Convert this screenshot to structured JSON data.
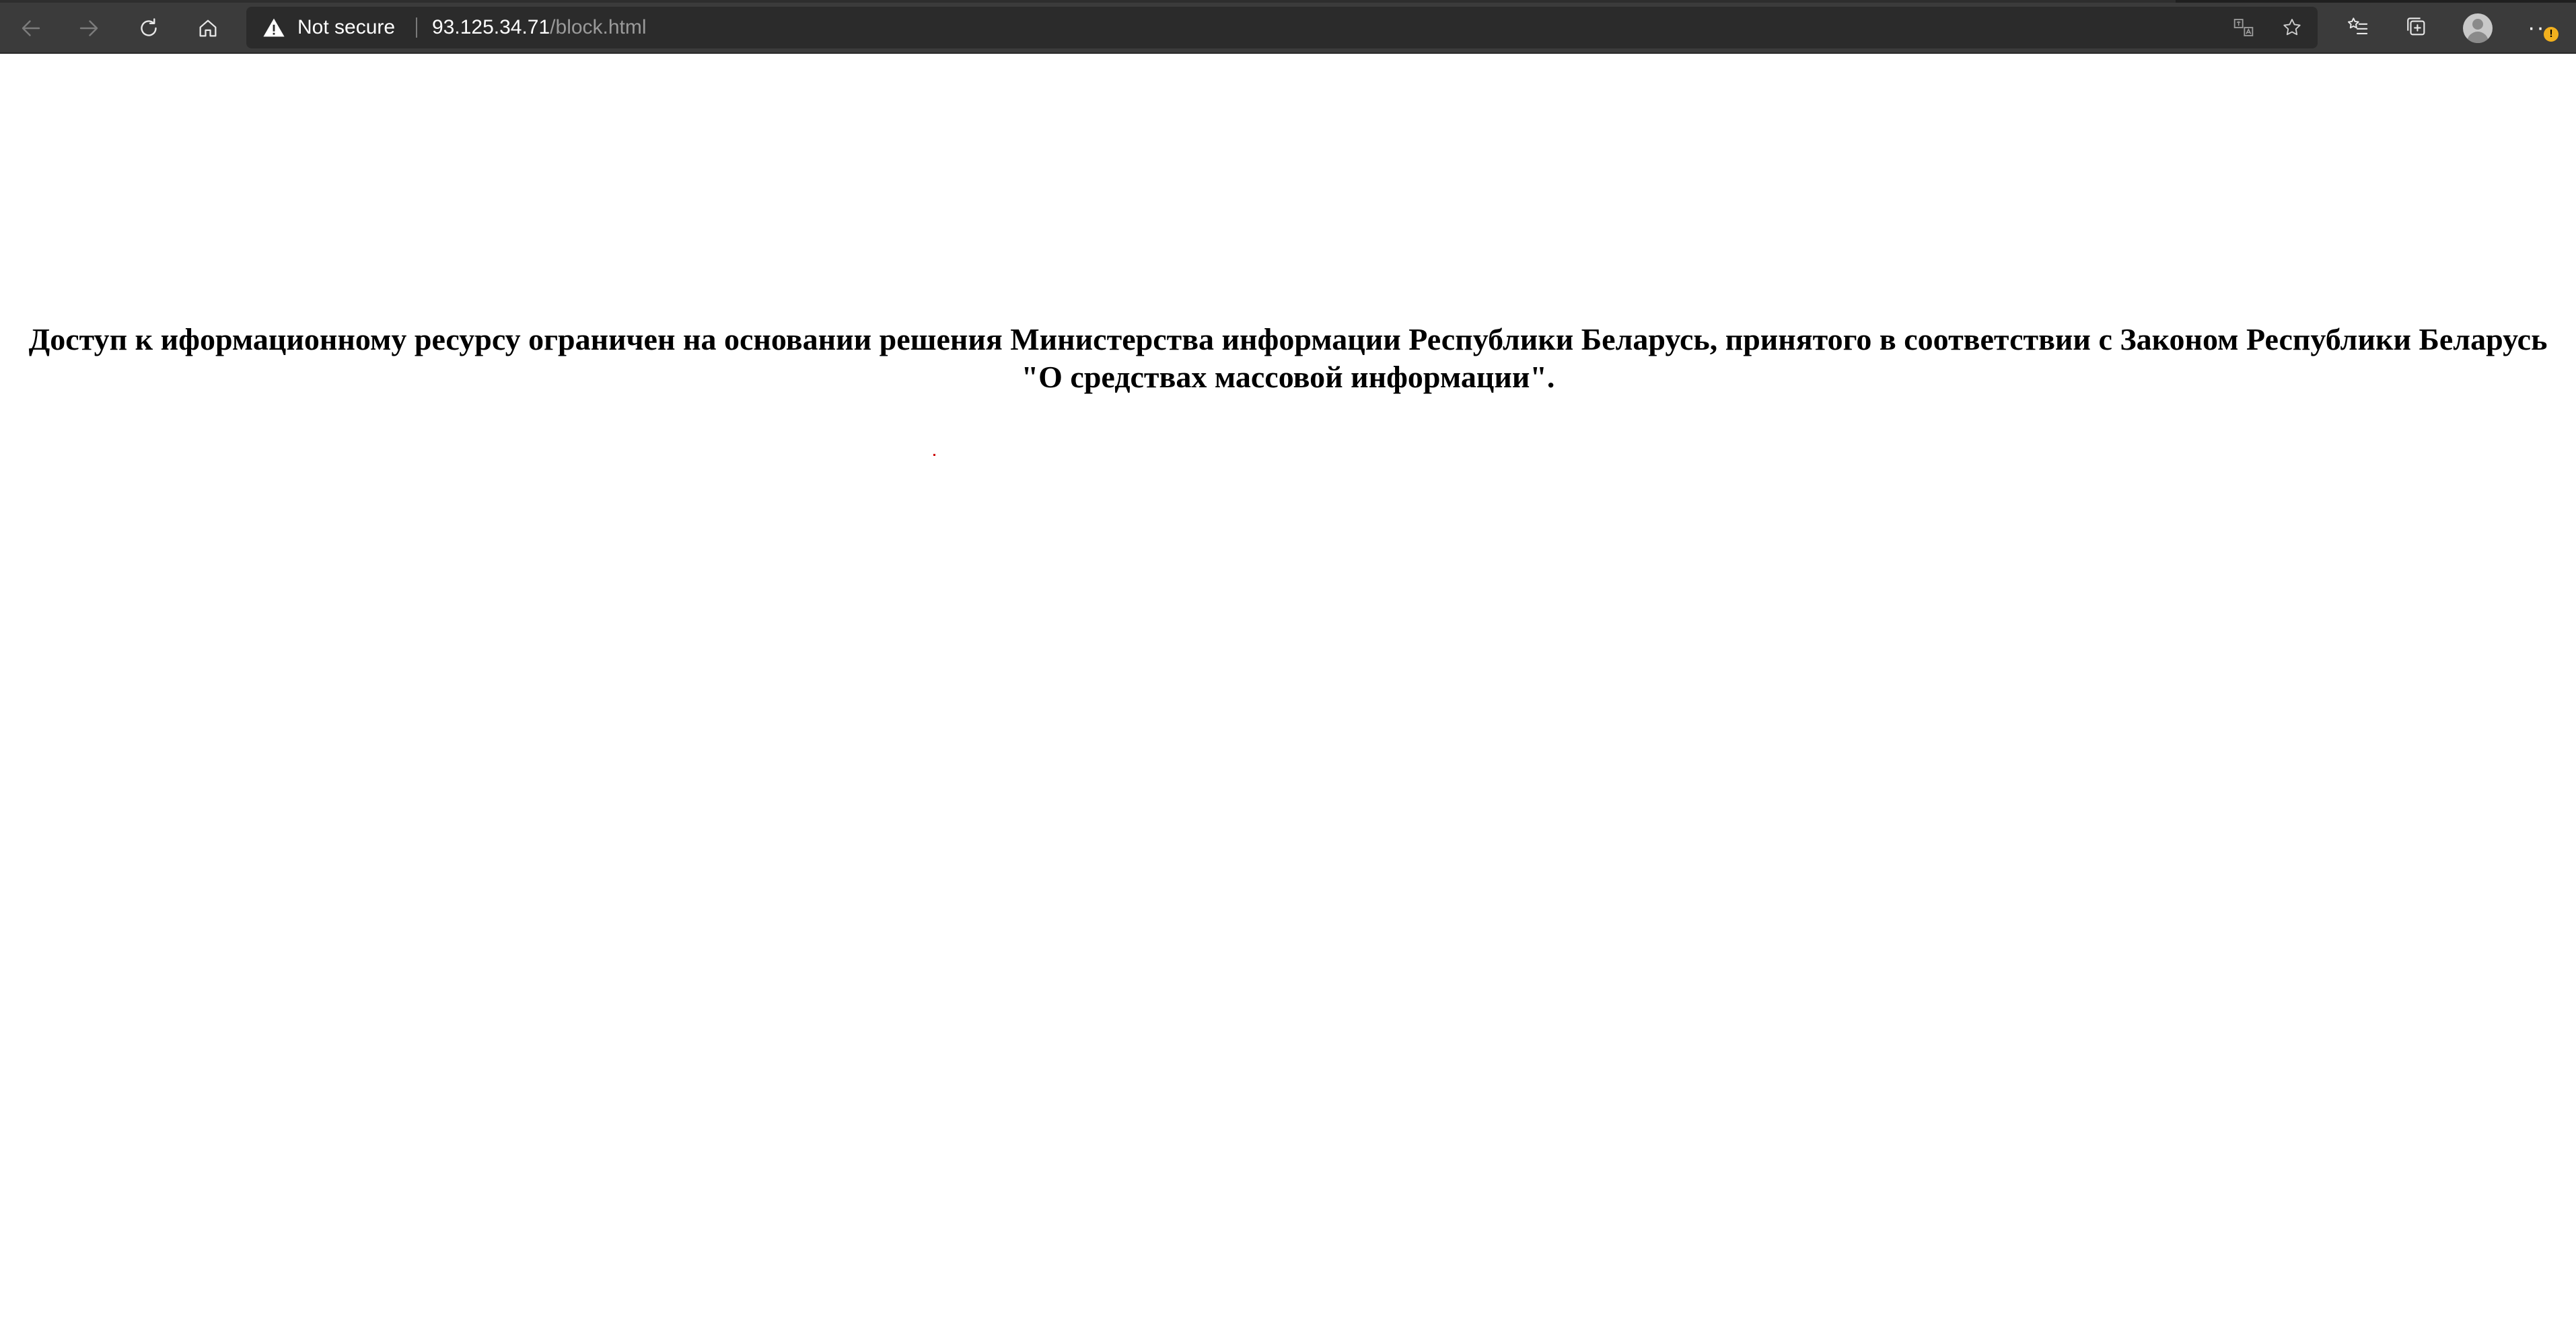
{
  "browser": {
    "address_bar": {
      "security_label": "Not secure",
      "url_host": "93.125.34.71",
      "url_path": "/block.html"
    },
    "profile_badge": "!",
    "more_label": "···",
    "icons": {
      "back": "arrow-left-icon",
      "forward": "arrow-right-icon",
      "reload": "reload-icon",
      "home": "home-icon",
      "warning": "warning-triangle-icon",
      "translate": "translate-icon",
      "favorite": "star-icon",
      "favorites_list": "favorites-list-icon",
      "collections": "collections-icon",
      "profile": "profile-icon",
      "more": "more-icon"
    },
    "colors": {
      "toolbar": "#3b3b3b",
      "address_bar": "#2b2b2b",
      "badge": "#f2b01e"
    }
  },
  "page": {
    "message": "Доступ к иформационному ресурсу ограничен на основании решения Министерства информации Республики Беларусь, принятого в соответствии с Законом Республики Беларусь \"О средствах массовой информации\"."
  }
}
